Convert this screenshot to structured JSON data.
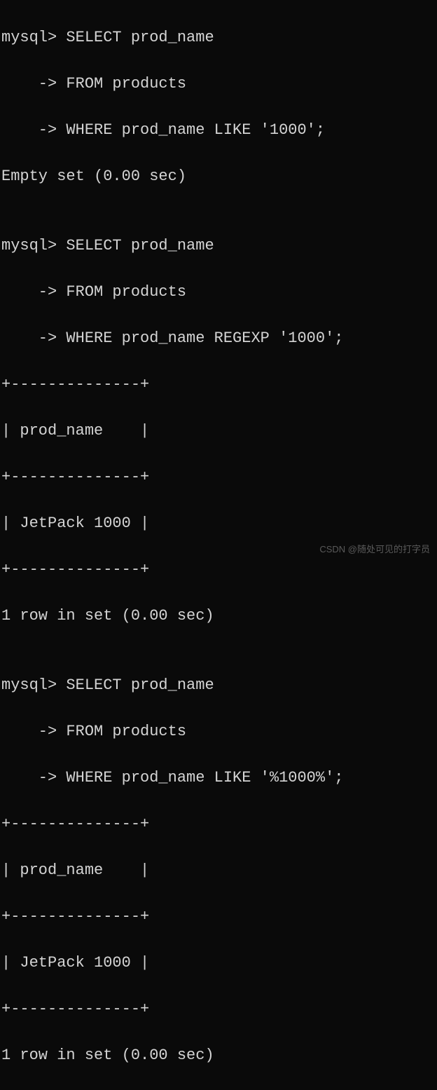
{
  "terminal": {
    "lines": [
      "mysql> SELECT prod_name",
      "    -> FROM products",
      "    -> WHERE prod_name LIKE '1000';",
      "Empty set (0.00 sec)",
      "",
      "mysql> SELECT prod_name",
      "    -> FROM products",
      "    -> WHERE prod_name REGEXP '1000';",
      "+--------------+",
      "| prod_name    |",
      "+--------------+",
      "| JetPack 1000 |",
      "+--------------+",
      "1 row in set (0.00 sec)",
      "",
      "mysql> SELECT prod_name",
      "    -> FROM products",
      "    -> WHERE prod_name LIKE '%1000%';",
      "+--------------+",
      "| prod_name    |",
      "+--------------+",
      "| JetPack 1000 |",
      "+--------------+",
      "1 row in set (0.00 sec)"
    ]
  },
  "watermark": "CSDN @随处可见的打字员"
}
